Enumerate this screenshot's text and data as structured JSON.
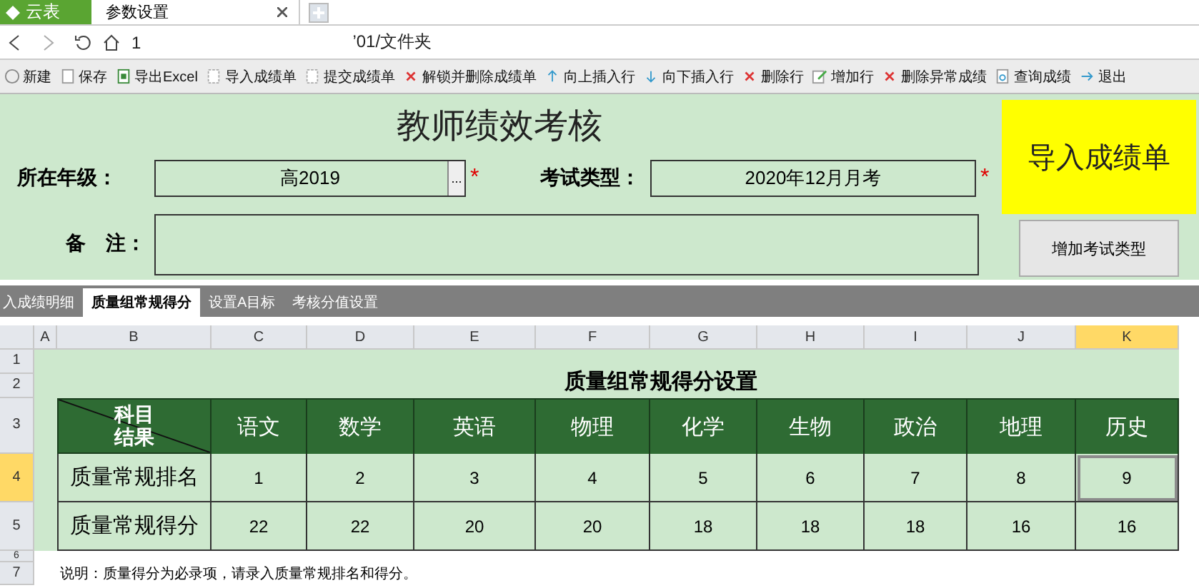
{
  "app_menu": {
    "label": "云表"
  },
  "tabs": [
    {
      "label": "参数设置",
      "selected": true
    }
  ],
  "address": {
    "parts": [
      "1",
      "’01/文件夹"
    ]
  },
  "toolbar": [
    {
      "label": "新建"
    },
    {
      "label": "保存"
    },
    {
      "label": "导出Excel"
    },
    {
      "label": "导入成绩单"
    },
    {
      "label": "提交成绩单"
    },
    {
      "label": "解锁并删除成绩单"
    },
    {
      "label": "向上插入行"
    },
    {
      "label": "向下插入行"
    },
    {
      "label": "删除行"
    },
    {
      "label": "增加行"
    },
    {
      "label": "删除异常成绩"
    },
    {
      "label": "查询成绩"
    },
    {
      "label": "退出"
    }
  ],
  "form": {
    "title": "教师绩效考核",
    "fields": [
      {
        "label": "所在年级：",
        "value": "高2019",
        "picker": "...",
        "required_mark": "*"
      },
      {
        "label": "考试类型：",
        "value": "2020年12月月考",
        "required_mark": "*"
      }
    ],
    "note_label": "备　注：",
    "import_button": "导入成绩单",
    "add_type_button": "增加考试类型"
  },
  "sheet_tabs": [
    {
      "label": "入成绩明细",
      "selected": false
    },
    {
      "label": "质量组常规得分",
      "selected": true
    },
    {
      "label": "设置A目标",
      "selected": false
    },
    {
      "label": "考核分值设置",
      "selected": false
    }
  ],
  "grid": {
    "columns": [
      {
        "label": "A",
        "selected": false
      },
      {
        "label": "B",
        "selected": false
      },
      {
        "label": "C",
        "selected": false
      },
      {
        "label": "D",
        "selected": false
      },
      {
        "label": "E",
        "selected": false
      },
      {
        "label": "F",
        "selected": false
      },
      {
        "label": "G",
        "selected": false
      },
      {
        "label": "H",
        "selected": false
      },
      {
        "label": "I",
        "selected": false
      },
      {
        "label": "J",
        "selected": false
      },
      {
        "label": "K",
        "selected": true
      }
    ],
    "rows": [
      {
        "label": "1",
        "selected": false
      },
      {
        "label": "2",
        "selected": false
      },
      {
        "label": "3",
        "selected": false
      },
      {
        "label": "4",
        "selected": true
      },
      {
        "label": "5",
        "selected": false
      },
      {
        "label": "6",
        "selected": false
      },
      {
        "label": "7",
        "selected": false
      }
    ]
  },
  "table": {
    "title": "质量组常规得分设置",
    "corner_top": "科目",
    "corner_bottom": "结果",
    "subjects": [
      "语文",
      "数学",
      "英语",
      "物理",
      "化学",
      "生物",
      "政治",
      "地理",
      "历史"
    ],
    "rows": [
      {
        "label": "质量常规排名",
        "values": [
          {
            "text": "1",
            "selected": false
          },
          {
            "text": "2",
            "selected": false
          },
          {
            "text": "3",
            "selected": false
          },
          {
            "text": "4",
            "selected": false
          },
          {
            "text": "5",
            "selected": false
          },
          {
            "text": "6",
            "selected": false
          },
          {
            "text": "7",
            "selected": false
          },
          {
            "text": "8",
            "selected": false
          },
          {
            "text": "9",
            "selected": true
          }
        ]
      },
      {
        "label": "质量常规得分",
        "values": [
          {
            "text": "22",
            "selected": false
          },
          {
            "text": "22",
            "selected": false
          },
          {
            "text": "20",
            "selected": false
          },
          {
            "text": "20",
            "selected": false
          },
          {
            "text": "18",
            "selected": false
          },
          {
            "text": "18",
            "selected": false
          },
          {
            "text": "18",
            "selected": false
          },
          {
            "text": "16",
            "selected": false
          },
          {
            "text": "16",
            "selected": false
          }
        ]
      }
    ]
  },
  "note": "说明：质量得分为必录项，请录入质量常规排名和得分。"
}
